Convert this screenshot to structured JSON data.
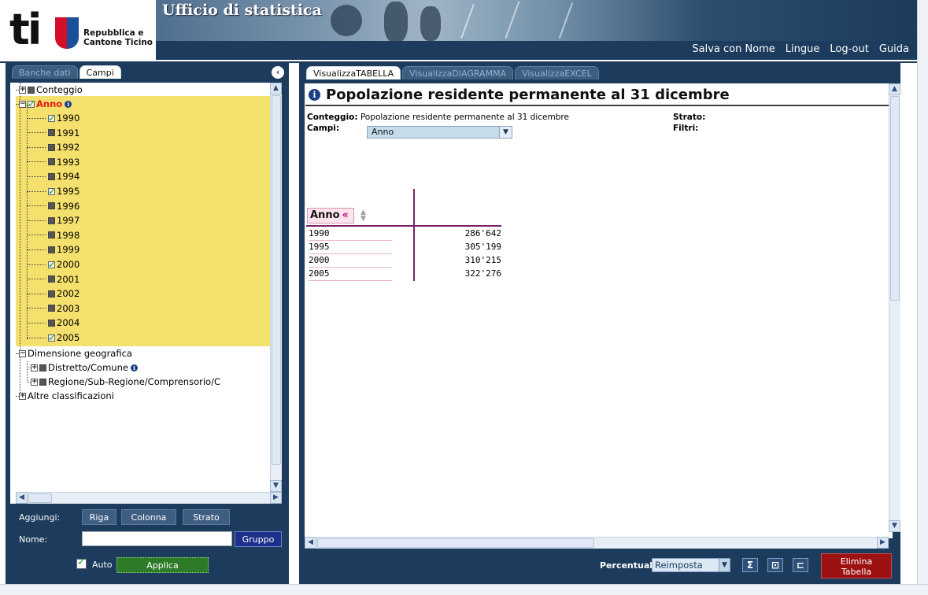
{
  "header": {
    "site_title": "Ufficio di statistica",
    "logo_text": "ti",
    "logo_line1": "Repubblica e",
    "logo_line2": "Cantone Ticino",
    "nav": [
      "Salva con Nome",
      "Lingue",
      "Log-out",
      "Guida"
    ]
  },
  "left_panel": {
    "tabs": [
      {
        "label": "Banche dati",
        "active": false
      },
      {
        "label": "Campi",
        "active": true
      }
    ],
    "tree": {
      "conteggio": "Conteggio",
      "anno": "Anno",
      "years": [
        {
          "label": "1990",
          "checked": true
        },
        {
          "label": "1991",
          "checked": false
        },
        {
          "label": "1992",
          "checked": false
        },
        {
          "label": "1993",
          "checked": false
        },
        {
          "label": "1994",
          "checked": false
        },
        {
          "label": "1995",
          "checked": true
        },
        {
          "label": "1996",
          "checked": false
        },
        {
          "label": "1997",
          "checked": false
        },
        {
          "label": "1998",
          "checked": false
        },
        {
          "label": "1999",
          "checked": false
        },
        {
          "label": "2000",
          "checked": true
        },
        {
          "label": "2001",
          "checked": false
        },
        {
          "label": "2002",
          "checked": false
        },
        {
          "label": "2003",
          "checked": false
        },
        {
          "label": "2004",
          "checked": false
        },
        {
          "label": "2005",
          "checked": true
        }
      ],
      "dimensione": "Dimensione geografica",
      "distretto": "Distretto/Comune",
      "regione": "Regione/Sub-Regione/Comprensorio/C",
      "altre": "Altre classificazioni"
    },
    "aggiungi_label": "Aggiungi:",
    "btn_riga": "Riga",
    "btn_colonna": "Colonna",
    "btn_strato": "Strato",
    "nome_label": "Nome:",
    "nome_value": "",
    "btn_gruppo": "Gruppo",
    "auto_label": "Auto",
    "btn_applica": "Applica"
  },
  "right_panel": {
    "tabs": [
      {
        "label": "VisualizzaTABELLA",
        "active": true
      },
      {
        "label": "VisualizzaDIAGRAMMA",
        "active": false
      },
      {
        "label": "VisualizzaEXCEL",
        "active": false
      }
    ],
    "title": "Popolazione residente permanente al 31 dicembre",
    "conteggio_label": "Conteggio:",
    "conteggio_value": "Popolazione residente permanente al 31 dicembre",
    "campi_label": "Campi:",
    "campi_value": "Anno",
    "strato_label": "Strato:",
    "filtri_label": "Filtri:",
    "table": {
      "row_header": "Anno",
      "row_header_icon": "«",
      "rows": [
        {
          "anno": "1990",
          "valore": "286'642"
        },
        {
          "anno": "1995",
          "valore": "305'199"
        },
        {
          "anno": "2000",
          "valore": "310'215"
        },
        {
          "anno": "2005",
          "valore": "322'276"
        }
      ]
    },
    "percentuale_label": "Percentuale:",
    "percentuale_value": "Reimposta",
    "btn_elimina_line1": "Elimina",
    "btn_elimina_line2": "Tabella"
  }
}
